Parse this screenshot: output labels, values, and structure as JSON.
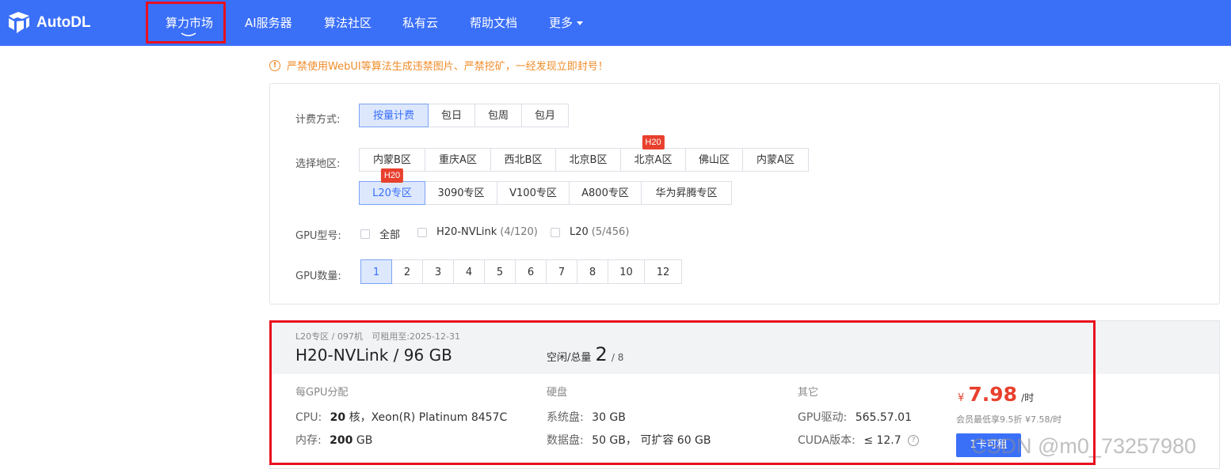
{
  "header": {
    "logo_text": "AutoDL",
    "nav": [
      {
        "label": "算力市场",
        "active": true
      },
      {
        "label": "AI服务器"
      },
      {
        "label": "算法社区"
      },
      {
        "label": "私有云"
      },
      {
        "label": "帮助文档"
      },
      {
        "label": "更多"
      }
    ],
    "colors": {
      "bar": "#3a6ff8",
      "highlight": "#e8101e"
    }
  },
  "warning": {
    "icon": "exclamation-circle-icon",
    "text": "严禁使用WebUI等算法生成违禁图片、严禁挖矿，一经发现立即封号！"
  },
  "filters": {
    "billing": {
      "label": "计费方式:",
      "options": [
        "按量计费",
        "包日",
        "包周",
        "包月"
      ],
      "selected": "按量计费"
    },
    "region": {
      "label": "选择地区:",
      "row1": [
        "内蒙B区",
        "重庆A区",
        "西北B区",
        "北京B区",
        "北京A区",
        "佛山区",
        "内蒙A区"
      ],
      "row2": [
        "L20专区",
        "3090专区",
        "V100专区",
        "A800专区",
        "华为昇腾专区"
      ],
      "selected": "L20专区",
      "badge": "H20"
    },
    "gpu_model": {
      "label": "GPU型号:",
      "options": [
        {
          "name": "全部",
          "count": ""
        },
        {
          "name": "H20-NVLink",
          "count": "(4/120)"
        },
        {
          "name": "L20",
          "count": "(5/456)"
        }
      ]
    },
    "gpu_count": {
      "label": "GPU数量:",
      "options": [
        "1",
        "2",
        "3",
        "4",
        "5",
        "6",
        "7",
        "8",
        "10",
        "12"
      ],
      "selected": "1"
    }
  },
  "machine": {
    "location": "L20专区 / 097机",
    "rentable_until_label": "可租用至:",
    "rentable_until": "2025-12-31",
    "gpu": "H20-NVLink / 96 GB",
    "idle_label": "空闲/总量",
    "idle": "2",
    "total": "/ 8",
    "per_gpu_label": "每GPU分配",
    "cpu_label": "CPU:",
    "cpu_cores": "20",
    "cpu_unit": "核，Xeon(R) Platinum 8457C",
    "mem_label": "内存:",
    "mem": "200",
    "mem_unit": "GB",
    "disk_label": "硬盘",
    "sys_disk_label": "系统盘:",
    "sys_disk": "30 GB",
    "data_disk_label": "数据盘:",
    "data_disk": "50 GB，",
    "data_disk_expand": "可扩容 60 GB",
    "other_label": "其它",
    "driver_label": "GPU驱动:",
    "driver": "565.57.01",
    "cuda_label": "CUDA版本:",
    "cuda": "≤ 12.7",
    "currency": "¥",
    "price": "7.98",
    "price_unit": "/时",
    "member_price": "会员最低享9.5折 ¥7.58/时",
    "rent_button": "1卡可租",
    "price_color": "#e8402d"
  },
  "watermark": "CSDN @m0_73257980"
}
